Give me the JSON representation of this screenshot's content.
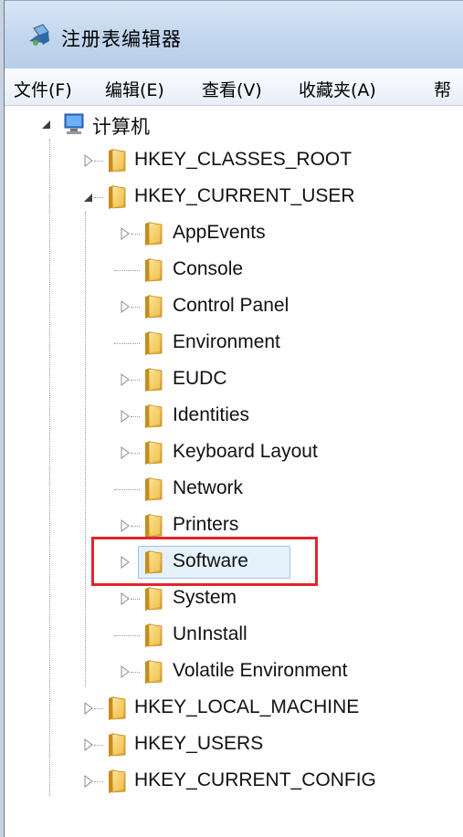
{
  "window": {
    "title": "注册表编辑器",
    "app_icon": "regedit-icon"
  },
  "menu": [
    {
      "label": "文件(F)",
      "hotkey": "F"
    },
    {
      "label": "编辑(E)",
      "hotkey": "E"
    },
    {
      "label": "查看(V)",
      "hotkey": "V"
    },
    {
      "label": "收藏夹(A)",
      "hotkey": "A"
    },
    {
      "label": "帮"
    }
  ],
  "tree": {
    "root": {
      "label": "计算机",
      "icon": "computer-icon",
      "expanded": true
    },
    "hives": [
      {
        "label": "HKEY_CLASSES_ROOT",
        "expanded": false
      },
      {
        "label": "HKEY_CURRENT_USER",
        "expanded": true,
        "children": [
          {
            "label": "AppEvents",
            "has_children": true
          },
          {
            "label": "Console",
            "has_children": false
          },
          {
            "label": "Control Panel",
            "has_children": true
          },
          {
            "label": "Environment",
            "has_children": false
          },
          {
            "label": "EUDC",
            "has_children": true
          },
          {
            "label": "Identities",
            "has_children": true
          },
          {
            "label": "Keyboard Layout",
            "has_children": true
          },
          {
            "label": "Network",
            "has_children": false
          },
          {
            "label": "Printers",
            "has_children": true
          },
          {
            "label": "Software",
            "has_children": true,
            "selected": true
          },
          {
            "label": "System",
            "has_children": true
          },
          {
            "label": "UnInstall",
            "has_children": false
          },
          {
            "label": "Volatile Environment",
            "has_children": true
          }
        ]
      },
      {
        "label": "HKEY_LOCAL_MACHINE",
        "expanded": false
      },
      {
        "label": "HKEY_USERS",
        "expanded": false
      },
      {
        "label": "HKEY_CURRENT_CONFIG",
        "expanded": false
      }
    ]
  },
  "colors": {
    "highlight_border": "#e0262b",
    "selection_bg": "#e5f1fb",
    "folder": "#f2c14e"
  }
}
